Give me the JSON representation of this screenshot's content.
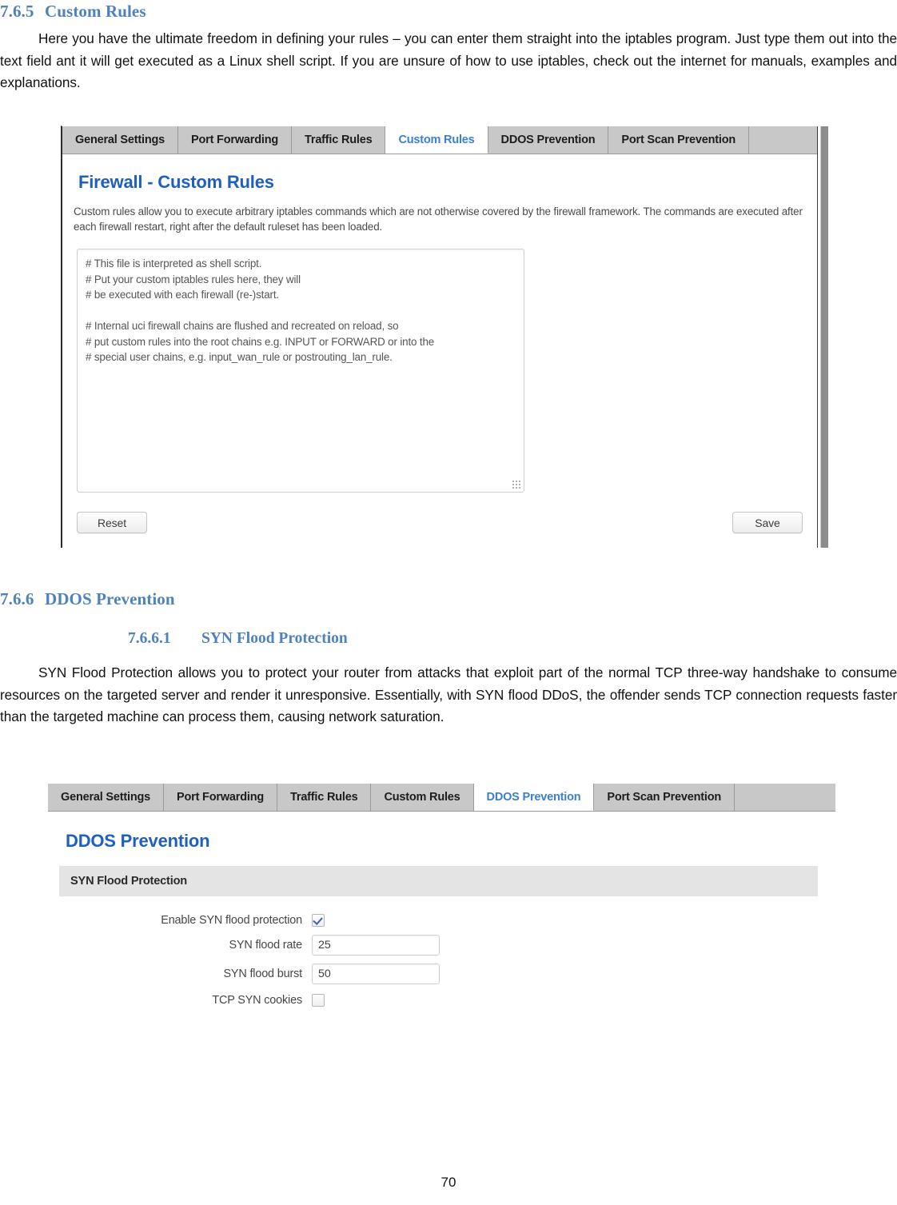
{
  "document": {
    "section_7_6_5": {
      "number": "7.6.5",
      "title": "Custom Rules",
      "paragraph": "Here you have the ultimate freedom in defining your rules – you can enter them straight into the iptables program. Just type them out into the text field ant it will get executed as a Linux shell script. If you are unsure of how to use iptables, check out the internet for manuals, examples and explanations."
    },
    "section_7_6_6": {
      "number": "7.6.6",
      "title": "DDOS Prevention"
    },
    "section_7_6_6_1": {
      "number": "7.6.6.1",
      "title": "SYN Flood Protection",
      "paragraph": "SYN Flood Protection allows you to protect your router from attacks that exploit part of the normal TCP three-way handshake to consume resources on the targeted server and render it unresponsive. Essentially, with SYN flood DDoS, the offender sends TCP connection requests faster than the targeted machine can process them, causing network saturation."
    },
    "page_number": "70"
  },
  "screenshot_custom_rules": {
    "tabs": [
      {
        "label": "General Settings",
        "active": false
      },
      {
        "label": "Port Forwarding",
        "active": false
      },
      {
        "label": "Traffic Rules",
        "active": false
      },
      {
        "label": "Custom Rules",
        "active": true
      },
      {
        "label": "DDOS Prevention",
        "active": false
      },
      {
        "label": "Port Scan Prevention",
        "active": false
      }
    ],
    "panel_title": "Firewall - Custom Rules",
    "panel_description": "Custom rules allow you to execute arbitrary iptables commands which are not otherwise covered by the firewall framework. The commands are executed after each firewall restart, right after the default ruleset has been loaded.",
    "textarea_value": "# This file is interpreted as shell script.\n# Put your custom iptables rules here, they will\n# be executed with each firewall (re-)start.\n\n# Internal uci firewall chains are flushed and recreated on reload, so\n# put custom rules into the root chains e.g. INPUT or FORWARD or into the\n# special user chains, e.g. input_wan_rule or postrouting_lan_rule.",
    "reset_button": "Reset",
    "save_button": "Save",
    "accent_color": "#3a7fd5",
    "title_color": "#1f5fbf"
  },
  "screenshot_ddos": {
    "tabs": [
      {
        "label": "General Settings",
        "active": false
      },
      {
        "label": "Port Forwarding",
        "active": false
      },
      {
        "label": "Traffic Rules",
        "active": false
      },
      {
        "label": "Custom Rules",
        "active": false
      },
      {
        "label": "DDOS Prevention",
        "active": true
      },
      {
        "label": "Port Scan Prevention",
        "active": false
      }
    ],
    "panel_title": "DDOS Prevention",
    "section_header": "SYN Flood Protection",
    "fields": {
      "enable_syn_flood_protection": {
        "label": "Enable SYN flood protection",
        "checked": true
      },
      "syn_flood_rate": {
        "label": "SYN flood rate",
        "value": "25"
      },
      "syn_flood_burst": {
        "label": "SYN flood burst",
        "value": "50"
      },
      "tcp_syn_cookies": {
        "label": "TCP SYN cookies",
        "checked": false
      }
    },
    "accent_color": "#3a7fd5",
    "title_color": "#1f5fbf"
  }
}
